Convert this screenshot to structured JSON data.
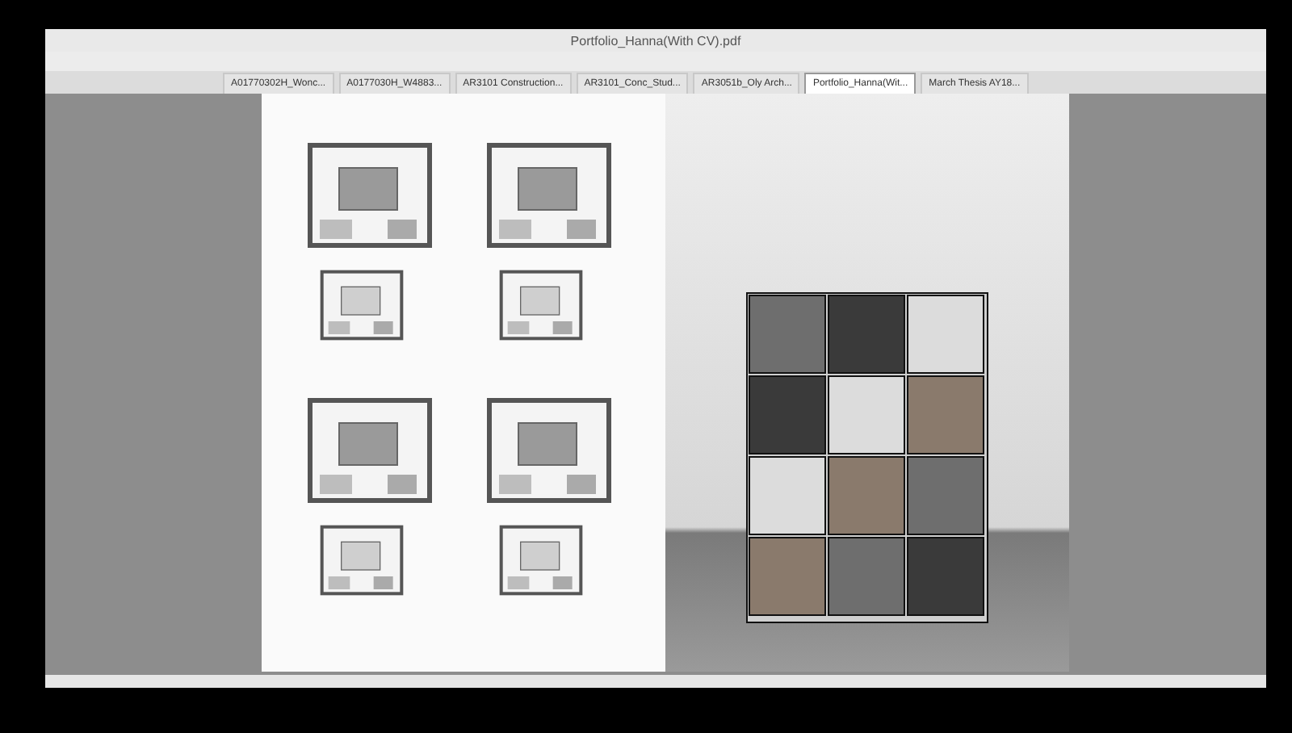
{
  "window": {
    "title": "Portfolio_Hanna(With CV).pdf"
  },
  "tabs": [
    {
      "label": "A01770302H_Wonc...",
      "selected": false
    },
    {
      "label": "A0177030H_W4883...",
      "selected": false
    },
    {
      "label": "AR3101 Construction...",
      "selected": false
    },
    {
      "label": "AR3101_Conc_Stud...",
      "selected": false
    },
    {
      "label": "AR3051b_Oly Arch...",
      "selected": false
    },
    {
      "label": "Portfolio_Hanna(Wit...",
      "selected": true
    },
    {
      "label": "March Thesis AY18...",
      "selected": false
    }
  ],
  "document": {
    "pages": [
      {
        "kind": "plans"
      },
      {
        "kind": "section"
      }
    ]
  }
}
